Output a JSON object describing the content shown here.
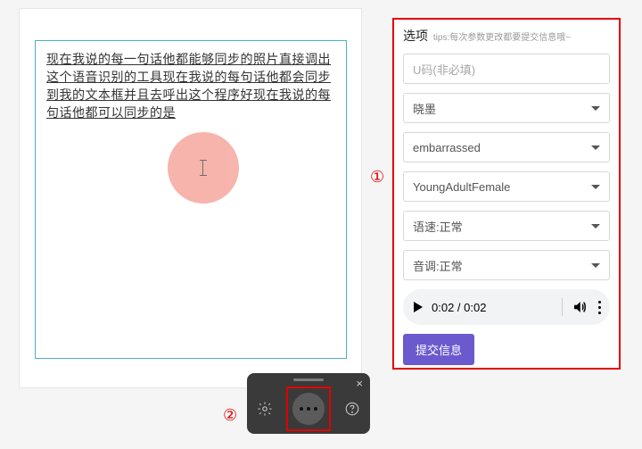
{
  "textarea": {
    "content": "现在我说的每一句话他都能够同步的照片直接调出这个语音识别的工具现在我说的每句话他都会同步到我的文本框并且去呼出这个程序好现在我说的每句话他都可以同步的是"
  },
  "options": {
    "title": "选项",
    "tips": "tips:每次参数更改都要提交信息哦~",
    "ucode_placeholder": "U码(非必填)",
    "voice": "晓墨",
    "emotion": "embarrassed",
    "gender": "YoungAdultFemale",
    "speed": "语速:正常",
    "pitch": "音调:正常",
    "audio": {
      "time": "0:02 / 0:02"
    },
    "submit": "提交信息"
  },
  "callouts": {
    "one": "①",
    "two": "②"
  },
  "toolbar": {
    "settings": "settings",
    "more": "more",
    "help": "help",
    "close": "×"
  }
}
